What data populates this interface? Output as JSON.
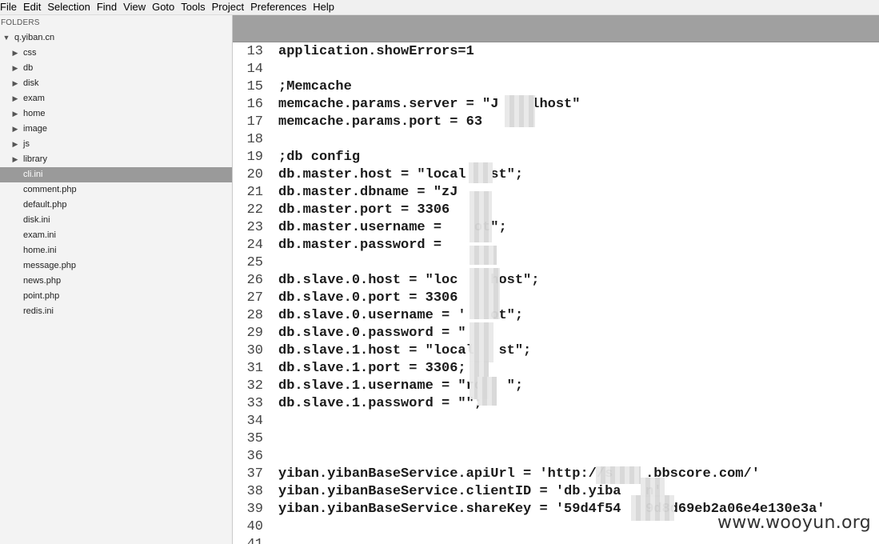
{
  "menu": [
    "File",
    "Edit",
    "Selection",
    "Find",
    "View",
    "Goto",
    "Tools",
    "Project",
    "Preferences",
    "Help"
  ],
  "sidebar": {
    "title": "FOLDERS",
    "tree": [
      {
        "label": "q.yiban.cn",
        "type": "folder-open",
        "depth": 0
      },
      {
        "label": "css",
        "type": "folder",
        "depth": 1
      },
      {
        "label": "db",
        "type": "folder",
        "depth": 1
      },
      {
        "label": "disk",
        "type": "folder",
        "depth": 1
      },
      {
        "label": "exam",
        "type": "folder",
        "depth": 1
      },
      {
        "label": "home",
        "type": "folder",
        "depth": 1
      },
      {
        "label": "image",
        "type": "folder",
        "depth": 1
      },
      {
        "label": "js",
        "type": "folder",
        "depth": 1
      },
      {
        "label": "library",
        "type": "folder",
        "depth": 1
      },
      {
        "label": "cli.ini",
        "type": "file",
        "depth": 1,
        "selected": true
      },
      {
        "label": "comment.php",
        "type": "file",
        "depth": 1
      },
      {
        "label": "default.php",
        "type": "file",
        "depth": 1
      },
      {
        "label": "disk.ini",
        "type": "file",
        "depth": 1
      },
      {
        "label": "exam.ini",
        "type": "file",
        "depth": 1
      },
      {
        "label": "home.ini",
        "type": "file",
        "depth": 1
      },
      {
        "label": "message.php",
        "type": "file",
        "depth": 1
      },
      {
        "label": "news.php",
        "type": "file",
        "depth": 1
      },
      {
        "label": "point.php",
        "type": "file",
        "depth": 1
      },
      {
        "label": "redis.ini",
        "type": "file",
        "depth": 1
      }
    ]
  },
  "editor": {
    "lines": [
      {
        "n": "13",
        "text": "application.showErrors=1"
      },
      {
        "n": "14",
        "text": ""
      },
      {
        "n": "15",
        "text": ";Memcache"
      },
      {
        "n": "16",
        "text": "memcache.params.server = \"J    lhost\""
      },
      {
        "n": "17",
        "text": "memcache.params.port = 63"
      },
      {
        "n": "18",
        "text": ""
      },
      {
        "n": "19",
        "text": ";db config"
      },
      {
        "n": "20",
        "text": "db.master.host = \"local   st\";"
      },
      {
        "n": "21",
        "text": "db.master.dbname = \"zJ"
      },
      {
        "n": "22",
        "text": "db.master.port = 3306"
      },
      {
        "n": "23",
        "text": "db.master.username =    ot\";"
      },
      {
        "n": "24",
        "text": "db.master.password ="
      },
      {
        "n": "25",
        "text": ""
      },
      {
        "n": "26",
        "text": "db.slave.0.host = \"loc    host\";"
      },
      {
        "n": "27",
        "text": "db.slave.0.port = 3306"
      },
      {
        "n": "28",
        "text": "db.slave.0.username = '   ot\";"
      },
      {
        "n": "29",
        "text": "db.slave.0.password = \""
      },
      {
        "n": "30",
        "text": "db.slave.1.host = \"local   st\";"
      },
      {
        "n": "31",
        "text": "db.slave.1.port = 3306;"
      },
      {
        "n": "32",
        "text": "db.slave.1.username = \"ro   \";"
      },
      {
        "n": "33",
        "text": "db.slave.1.password = \"\";"
      },
      {
        "n": "34",
        "text": ""
      },
      {
        "n": "35",
        "text": ""
      },
      {
        "n": "36",
        "text": ""
      },
      {
        "n": "37",
        "text": "yiban.yibanBaseService.apiUrl = 'http://s    .bbscore.com/'"
      },
      {
        "n": "38",
        "text": "yiban.yibanBaseService.clientID = 'db.yiba   n'"
      },
      {
        "n": "39",
        "text": "yiban.yibanBaseService.shareKey = '59d4f54   9d8d69eb2a06e4e130e3a'"
      },
      {
        "n": "40",
        "text": ""
      },
      {
        "n": "41",
        "text": ""
      }
    ]
  },
  "watermark": "www.wooyun.org"
}
